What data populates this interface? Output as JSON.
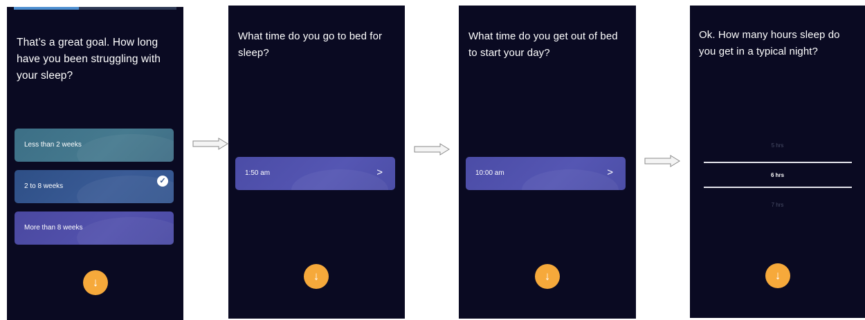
{
  "screens": [
    {
      "question": "That’s a great goal. How long have you been struggling with your sleep?",
      "progress": 0.4,
      "options": [
        {
          "label": "Less than 2 weeks",
          "selected": false
        },
        {
          "label": "2 to 8 weeks",
          "selected": true
        },
        {
          "label": "More than 8 weeks",
          "selected": false
        }
      ],
      "next_icon": "arrow-down-icon"
    },
    {
      "question": "What time do you go to bed for sleep?",
      "time_value": "1:50 am",
      "next_icon": "arrow-down-icon"
    },
    {
      "question": "What time do you get out of bed to start your day?",
      "time_value": "10:00 am",
      "next_icon": "arrow-down-icon"
    },
    {
      "question": "Ok. How many hours sleep do you get in a typical night?",
      "picker": {
        "prev": "5 hrs",
        "selected": "6 hrs",
        "next": "7 hrs"
      },
      "next_icon": "arrow-down-icon"
    }
  ],
  "colors": {
    "screen_bg": "#0a0a22",
    "accent_button": "#f6a93b",
    "option_1": "#467a8f",
    "option_2": "#3a5b96",
    "option_3": "#5352ad",
    "time_field": "#5556b3",
    "progress_fill": "#4d8fd0"
  },
  "icons": {
    "check": "check-icon",
    "chevron": "chevron-right-icon",
    "flow_arrow": "flow-arrow-icon"
  }
}
